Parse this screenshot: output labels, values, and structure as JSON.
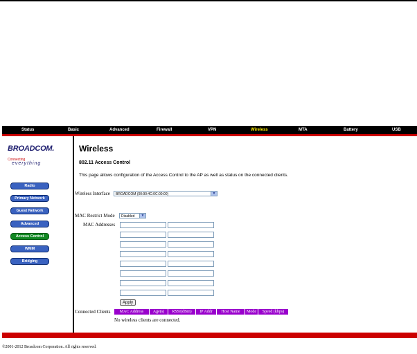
{
  "nav": {
    "items": [
      "Status",
      "Basic",
      "Advanced",
      "Firewall",
      "VPN",
      "Wireless",
      "MTA",
      "Battery",
      "USB"
    ],
    "active": "Wireless"
  },
  "logo": {
    "brand": "BROADCOM.",
    "tagline_top": "Connecting",
    "tagline_bottom": "everything"
  },
  "sidebar": {
    "items": [
      "Radio",
      "Primary Network",
      "Guest Network",
      "Advanced",
      "Access Control",
      "WMM",
      "Bridging"
    ],
    "active": "Access Control"
  },
  "main": {
    "title": "Wireless",
    "subtitle": "802.11 Access Control",
    "description": "This page allows configuration of the Access Control to the AP as well as status on the connected clients.",
    "wireless_interface_label": "Wireless Interface",
    "wireless_interface_value": "BROADCOM (00:90:4C:0C:00:00)",
    "mac_restrict_label": "MAC Restrict Mode",
    "mac_restrict_value": "Disabled",
    "mac_addresses_label": "MAC Addresses",
    "apply_label": "Apply",
    "connected_clients_label": "Connected Clients",
    "table_headers": [
      "MAC Address",
      "Age(s)",
      "RSSI(dBm)",
      "IP Addr",
      "Host Name",
      "Mode",
      "Speed (kbps)"
    ],
    "no_clients_text": "No wireless clients are connected."
  },
  "footer": {
    "copyright": "©2001-2012 Broadcom Corporation. All rights reserved."
  },
  "colors": {
    "nav_bg": "#000000",
    "nav_active": "#ffee00",
    "accent_red": "#cc0000",
    "sidebar_button": "#3a62c0",
    "sidebar_button_active": "#118822",
    "table_header": "#9900cc"
  }
}
